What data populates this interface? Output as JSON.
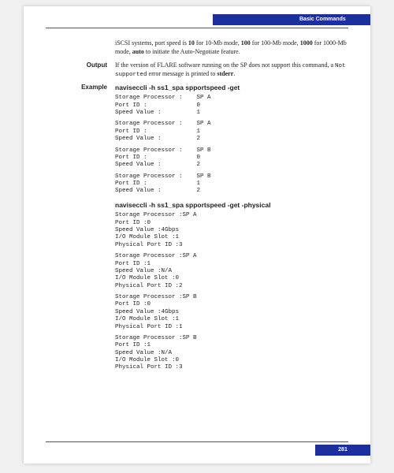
{
  "header": {
    "section": "Basic Commands"
  },
  "intro": {
    "text_a": "iSCSI systems, port speed is ",
    "v10": "10",
    "text_b": " for 10-Mb mode, ",
    "v100": "100",
    "text_c": " for 100-Mb mode, ",
    "v1000": "1000",
    "text_d": " for 1000-Mb mode, ",
    "vauto": "auto",
    "text_e": " to initiate the Auto-Negotiate feature."
  },
  "output": {
    "label": "Output",
    "text_a": "If the version of FLARE software running on the SP does not support this command, a ",
    "err": "Not supported",
    "text_b": " error message is printed to ",
    "stderr": "stderr",
    "text_c": "."
  },
  "example": {
    "label": "Example",
    "cmd1": "naviseccli   -h   ss1_spa  spportspeed  -get",
    "block1": "Storage Processor :    SP A\nPort ID :              0\nSpeed Value :          1",
    "block2": "Storage Processor :    SP A\nPort ID :              1\nSpeed Value :          2",
    "block3": "Storage Processor :    SP B\nPort ID :              0\nSpeed Value :          2",
    "block4": "Storage Processor :    SP B\nPort ID :              1\nSpeed Value :          2",
    "cmd2": "naviseccli   -h   ss1_spa  spportspeed  -get -physical",
    "block5": "Storage Processor :SP A\nPort ID :0\nSpeed Value :4Gbps\nI/O Module Slot :1\nPhysical Port ID :3",
    "block6": "Storage Processor :SP A\nPort ID :1\nSpeed Value :N/A\nI/O Module Slot :0\nPhysical Port ID :2",
    "block7": "Storage Processor :SP B\nPort ID :0\nSpeed Value :4Gbps\nI/O Module Slot :1\nPhysical Port ID :1",
    "block8": "Storage Processor :SP B\nPort ID :1\nSpeed Value :N/A\nI/O Module Slot :0\nPhysical Port ID :3"
  },
  "footer": {
    "page": "281"
  }
}
